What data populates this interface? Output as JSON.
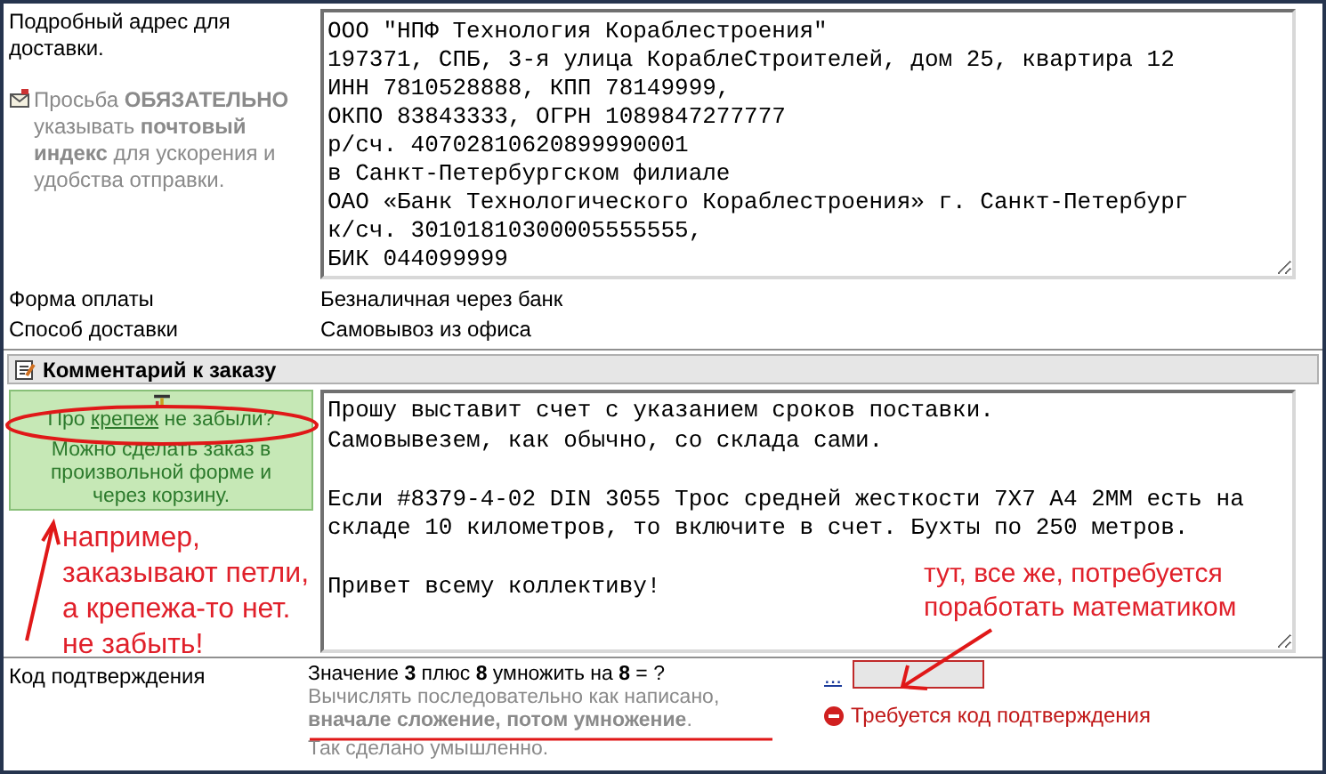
{
  "address": {
    "label": "Подробный адрес для доставки.",
    "hint": "Просьба **ОБЯЗАТЕЛЬНО** указывать **почтовый индекс** для ускорения и удобства отправки.",
    "value": "ООО \"НПФ Технология Кораблестроения\"\n197371, СПБ, 3-я улица КораблеСтроителей, дом 25, квартира 12\nИНН 7810528888, КПП 78149999,\nОКПО 83843333, ОГРН 1089847277777\nр/сч. 40702810620899990001\nв Санкт-Петербургском филиале\nОАО «Банк Технологического Кораблестроения» г. Санкт-Петербург\nк/сч. 30101810300005555555,\nБИК 044099999"
  },
  "payment": {
    "label": "Форма оплаты",
    "value": "Безналичная через банк"
  },
  "delivery": {
    "label": "Способ доставки",
    "value": "Самовывоз из офиса"
  },
  "comment": {
    "title": "Комментарий к заказу",
    "tip": {
      "before": "Про ",
      "link": "крепеж",
      "after": " не забыли?",
      "note": "Можно сделать заказ в произвольной форме и через корзину."
    },
    "value": "Прошу выставит счет с указанием сроков поставки.\nСамовывезем, как обычно, со склада сами.\n\nЕсли #8379-4-02 DIN 3055 Трос средней жесткости 7Х7 А4 2ММ есть на\nскладе 10 километров, то включите в счет. Бухты по 250 метров.\n\nПривет всему коллективу!"
  },
  "captcha": {
    "label": "Код подтверждения",
    "question": "Значение **3** плюс **8** умножить на **8** = ?",
    "hint": "Вычислять последовательно как написано, **вначале сложение, потом умножение**.",
    "note": "Так сделано умышленно.",
    "link": "...",
    "error": "Требуется код подтверждения"
  },
  "annotations": [
    {
      "text": "например,\nзаказывают петли,\nа крепежа-то нет.\nне забыть!"
    },
    {
      "text": "тут, все же, потребуется\nпоработать математиком"
    }
  ]
}
